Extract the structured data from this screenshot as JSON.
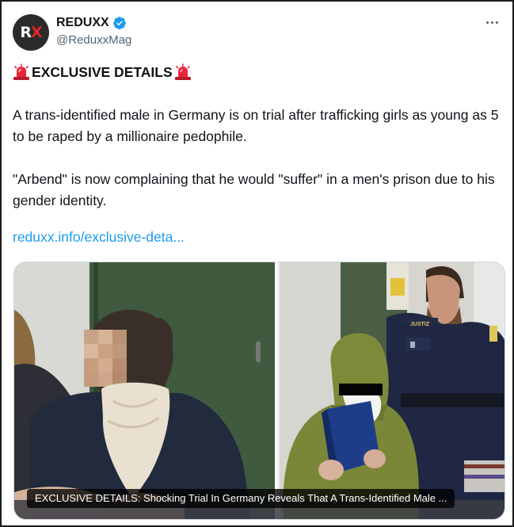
{
  "author": {
    "avatar_text_r": "R",
    "avatar_text_x": "X",
    "display_name": "REDUXX",
    "handle": "@ReduxxMag",
    "verified": true
  },
  "icons": {
    "verified": "verified-badge-icon",
    "more": "more-options-icon",
    "siren": "police-light-emoji"
  },
  "tweet": {
    "headline": "EXCLUSIVE DETAILS",
    "paragraphs": [
      "A trans-identified male in Germany is on trial after trafficking girls as young as 5 to be raped by a millionaire pedophile.",
      "\"Arbend\" is now complaining that he would \"suffer\" in a men's prison due to his gender identity."
    ],
    "link_text": "reduxx.info/exclusive-deta..."
  },
  "media": {
    "caption": "EXCLUSIVE DETAILS: Shocking Trial In Germany Reveals That A Trans-Identified Male ...",
    "officer_patch": "JUSTIZ"
  },
  "colors": {
    "link": "#1d9bf0",
    "verified": "#1d9bf0",
    "secondary_text": "#536471",
    "siren": "#e8283c"
  }
}
